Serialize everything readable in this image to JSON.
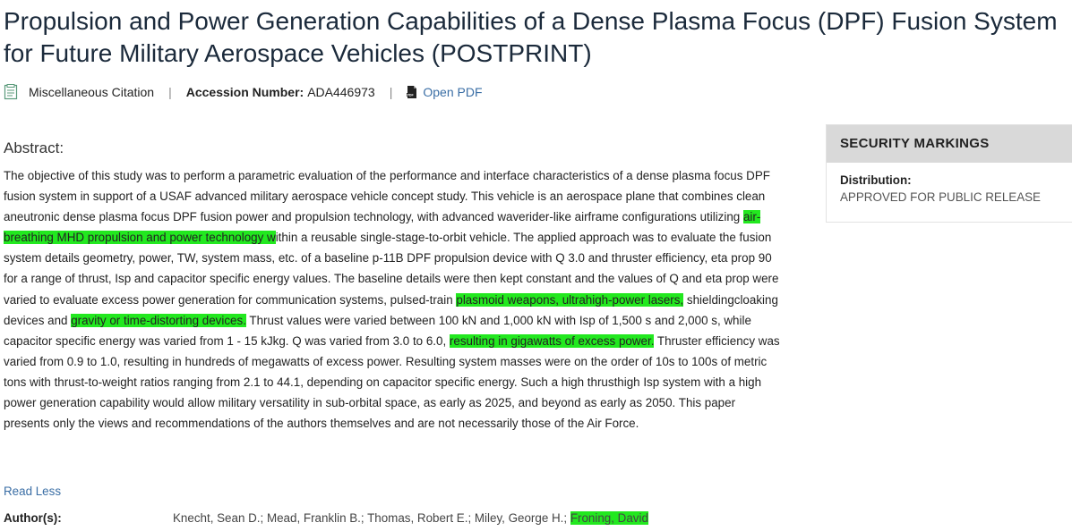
{
  "title": "Propulsion and Power Generation Capabilities of a Dense Plasma Focus (DPF) Fusion System for Future Military Aerospace Vehicles (POSTPRINT)",
  "meta": {
    "citation_type": "Miscellaneous Citation",
    "separator": "|",
    "accession_label": "Accession Number:",
    "accession_value": "ADA446973",
    "open_pdf": "Open PDF"
  },
  "abstract": {
    "label": "Abstract:",
    "segments": [
      {
        "text": "The objective of this study was to perform a parametric evaluation of the performance and interface characteristics of a dense plasma focus DPF fusion system in support of a USAF advanced military aerospace vehicle concept study. This vehicle is an aerospace plane that combines clean aneutronic dense plasma focus DPF fusion power and propulsion technology, with advanced waverider-like airframe configurations utilizing ",
        "highlight": false
      },
      {
        "text": "air-breathing MHD propulsion and power technology w",
        "highlight": true
      },
      {
        "text": "ithin a reusable single-stage-to-orbit vehicle. The applied approach was to evaluate the fusion system details geometry, power, TW, system mass, etc. of a baseline p-11B DPF propulsion device with Q 3.0 and thruster efficiency, eta prop 90 for a range of thrust, Isp and capacitor specific energy values. The baseline details were then kept constant and the values of Q and eta prop were varied to evaluate excess power generation for communication systems, pulsed-train ",
        "highlight": false
      },
      {
        "text": "plasmoid weapons, ultrahigh-power lasers,",
        "highlight": true
      },
      {
        "text": " shieldingcloaking devices and ",
        "highlight": false
      },
      {
        "text": "gravity or time-distorting devices.",
        "highlight": true
      },
      {
        "text": " Thrust values were varied between 100 kN and 1,000 kN with Isp of 1,500 s and 2,000 s, while capacitor specific energy was varied from 1 - 15 kJkg. Q was varied from 3.0 to 6.0, ",
        "highlight": false
      },
      {
        "text": "resulting in gigawatts of excess power.",
        "highlight": true
      },
      {
        "text": " Thruster efficiency was varied from 0.9 to 1.0, resulting in hundreds of megawatts of excess power. Resulting system masses were on the order of 10s to 100s of metric tons with thrust-to-weight ratios ranging from 2.1 to 44.1, depending on capacitor specific energy. Such a high thrusthigh Isp system with a high power generation capability would allow military versatility in sub-orbital space, as early as 2025, and beyond as early as 2050. This paper presents only the views and recommendations of the authors themselves and are not necessarily those of the Air Force.",
        "highlight": false
      }
    ],
    "read_less": "Read Less"
  },
  "authors": {
    "label": "Author(s):",
    "names": "Knecht, Sean D.; Mead, Franklin B.; Thomas, Robert E.; Miley, George H.;",
    "highlighted_name": "Froning, David"
  },
  "sidebar": {
    "heading": "SECURITY MARKINGS",
    "distribution_label": "Distribution:",
    "distribution_value": "APPROVED FOR PUBLIC RELEASE"
  },
  "colors": {
    "highlight": "#22e81f",
    "link": "#3a6ea5",
    "title": "#1b2a3b",
    "sidebar_header_bg": "#d9d9d9"
  },
  "icons": {
    "citation": "citation-document-icon",
    "pdf": "pdf-file-icon"
  }
}
